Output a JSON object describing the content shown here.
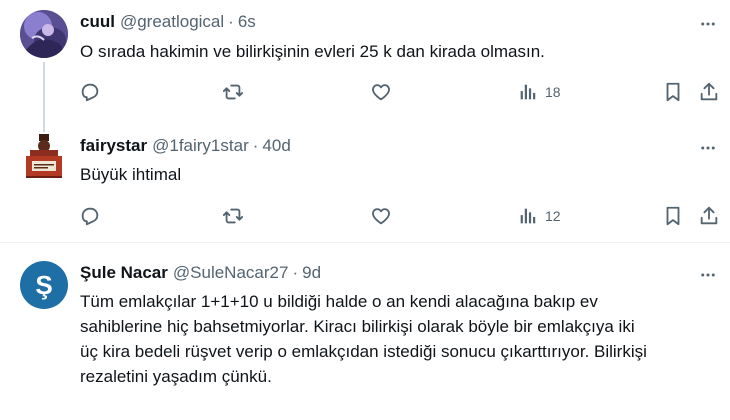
{
  "tweets": [
    {
      "name": "cuul",
      "handle": "@greatlogical",
      "separator": "·",
      "time": "6s",
      "text": "O sırada hakimin ve bilirkişinin evleri 25 k dan kirada olmasın.",
      "views": "18",
      "avatar": "abstract-purple-avatar"
    },
    {
      "name": "fairystar",
      "handle": "@1fairy1star",
      "separator": "·",
      "time": "40d",
      "text": "Büyük ihtimal",
      "views": "12",
      "avatar": "gavel-desk-avatar"
    },
    {
      "name": "Şule Nacar",
      "handle": "@SuleNacar27",
      "separator": "·",
      "time": "9d",
      "text_lines": [
        "Tüm emlakçılar 1+1+10 u bildiği halde o an kendi alacağına bakıp ev",
        "sahiblerine hiç bahsetmiyorlar. Kiracı bilirkişi olarak böyle bir emlakçıya iki",
        "üç kira bedeli rüşvet verip o emlakçıdan istediği sonucu çıkarttırıyor. Bilirkişi",
        "rezaletini yaşadım çünkü."
      ],
      "avatar_letter": "Ş",
      "avatar_color": "#1d6fa5"
    }
  ],
  "colors": {
    "icon": "#536471",
    "text": "#0f1419",
    "divider": "#eff3f4",
    "thread_line": "#cfd9de"
  },
  "icons": [
    "reply-icon",
    "retweet-icon",
    "like-icon",
    "views-icon",
    "bookmark-icon",
    "share-icon",
    "more-icon"
  ]
}
